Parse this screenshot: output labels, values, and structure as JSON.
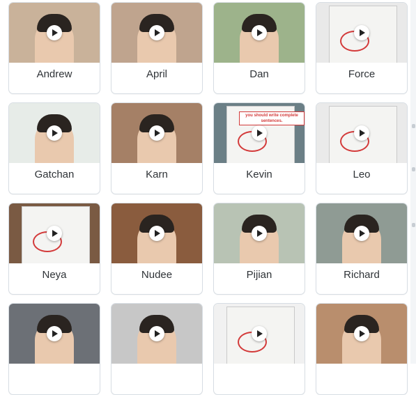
{
  "students": [
    {
      "name": "Andrew",
      "bg": "#c9b29a"
    },
    {
      "name": "April",
      "bg": "#bfa48e"
    },
    {
      "name": "Dan",
      "bg": "#9db38b"
    },
    {
      "name": "Force",
      "bg": "#e9e9e9"
    },
    {
      "name": "Gatchan",
      "bg": "#e7ece8"
    },
    {
      "name": "Karn",
      "bg": "#a58066"
    },
    {
      "name": "Kevin",
      "bg": "#6b7f86",
      "banner": "you should write complete sentences."
    },
    {
      "name": "Leo",
      "bg": "#eaeaea"
    },
    {
      "name": "Neya",
      "bg": "#7a5a43"
    },
    {
      "name": "Nudee",
      "bg": "#8a5c3e"
    },
    {
      "name": "Pijian",
      "bg": "#b8c3b4"
    },
    {
      "name": "Richard",
      "bg": "#8f9b94"
    },
    {
      "name": "",
      "bg": "#6c7076"
    },
    {
      "name": "",
      "bg": "#c7c7c7"
    },
    {
      "name": "",
      "bg": "#f1f1f1"
    },
    {
      "name": "",
      "bg": "#b98e6d"
    }
  ]
}
